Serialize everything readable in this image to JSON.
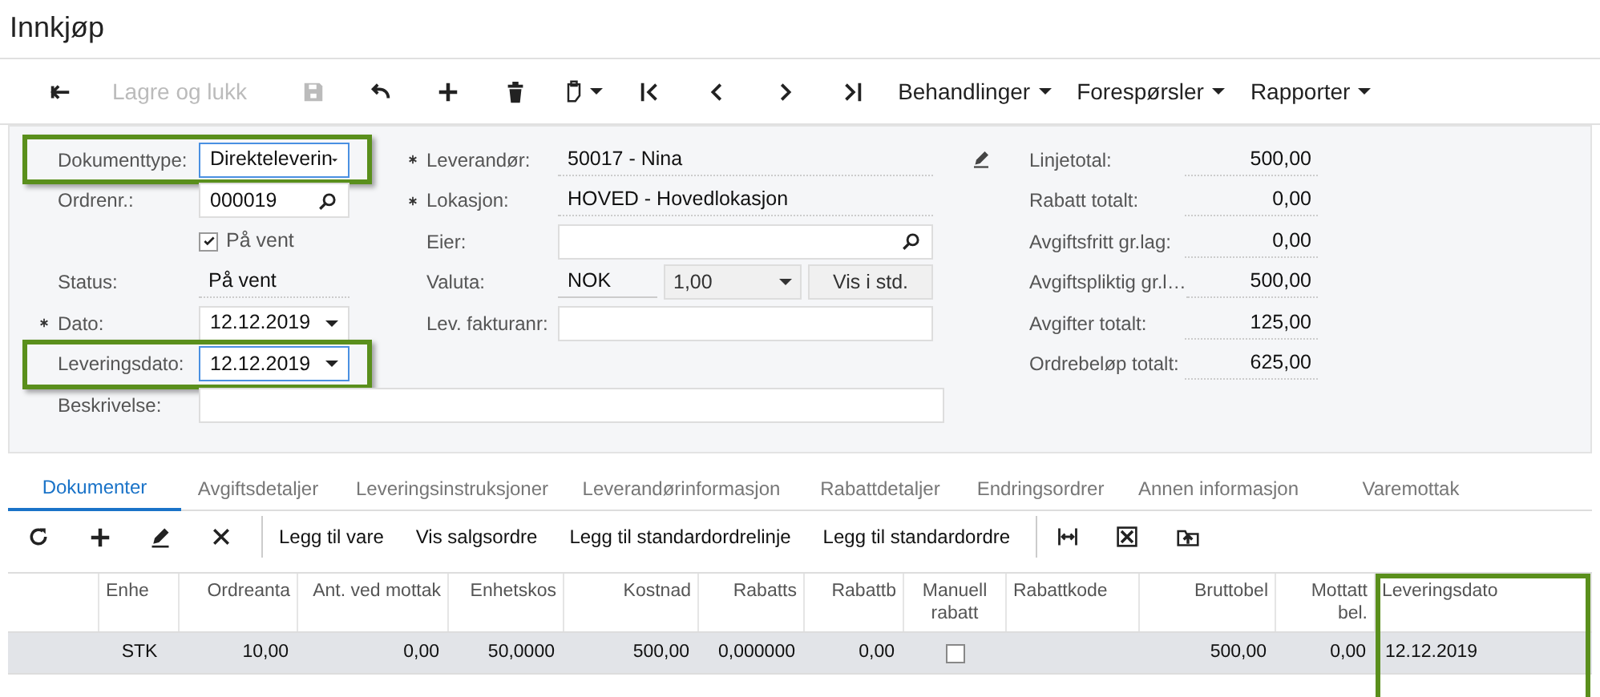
{
  "page_title": "Innkjøp",
  "toolbar": [
    {
      "kind": "back",
      "disabled": false
    },
    {
      "kind": "text",
      "label": "Lagre og lukk",
      "disabled": true
    },
    {
      "kind": "save",
      "disabled": true
    },
    {
      "kind": "undo",
      "disabled": false
    },
    {
      "kind": "add",
      "disabled": false
    },
    {
      "kind": "delete",
      "disabled": false
    },
    {
      "kind": "clipboard",
      "disabled": false
    },
    {
      "kind": "first",
      "disabled": false
    },
    {
      "kind": "prev",
      "disabled": false
    },
    {
      "kind": "next",
      "disabled": false
    },
    {
      "kind": "last",
      "disabled": false
    },
    {
      "kind": "menu",
      "label": "Behandlinger",
      "disabled": false
    },
    {
      "kind": "menu",
      "label": "Forespørsler",
      "disabled": false
    },
    {
      "kind": "menu",
      "label": "Rapporter",
      "disabled": false
    }
  ],
  "form_left": [
    {
      "kind": "select",
      "label": "Dokumenttype:",
      "value": "Direkteleverin",
      "required": false,
      "highlighted": true
    },
    {
      "kind": "lookup",
      "label": "Ordrenr.:",
      "value": "000019",
      "required": false,
      "highlighted": false
    },
    {
      "kind": "checkbox",
      "label": "På vent",
      "checked": true
    },
    {
      "kind": "readonly",
      "label": "Status:",
      "value": "På vent",
      "required": false,
      "highlighted": false
    },
    {
      "kind": "select",
      "label": "Dato:",
      "value": "12.12.2019",
      "required": true,
      "highlighted": false
    },
    {
      "kind": "select",
      "label": "Leveringsdato:",
      "value": "12.12.2019",
      "required": false,
      "highlighted": true
    },
    {
      "kind": "wide",
      "label": "Beskrivelse:",
      "required": false,
      "highlighted": false
    }
  ],
  "form_middle": [
    {
      "kind": "readonly",
      "label": "Leverandør:",
      "value": "50017 - Nina",
      "required": true
    },
    {
      "kind": "readonly",
      "label": "Lokasjon:",
      "value": "HOVED - Hovedlokasjon",
      "required": true
    },
    {
      "kind": "lookup",
      "label": "Eier:",
      "required": false
    },
    {
      "kind": "currency",
      "label": "Valuta:",
      "value": "NOK",
      "rate": "1,00",
      "button": "Vis i std.",
      "required": false
    },
    {
      "kind": "input",
      "label": "Lev. fakturanr:",
      "required": false
    }
  ],
  "totals": [
    {
      "label": "Linjetotal:",
      "value": "500,00"
    },
    {
      "label": "Rabatt totalt:",
      "value": "0,00"
    },
    {
      "label": "Avgiftsfritt gr.lag:",
      "value": "0,00"
    },
    {
      "label": "Avgiftspliktig gr.l…",
      "value": "500,00"
    },
    {
      "label": "Avgifter totalt:",
      "value": "125,00"
    },
    {
      "label": "Ordrebeløp totalt:",
      "value": "625,00"
    }
  ],
  "tabs": [
    {
      "label": "Dokumenter",
      "selected": true
    },
    {
      "label": "Avgiftsdetaljer",
      "selected": false
    },
    {
      "label": "Leveringsinstruksjoner",
      "selected": false
    },
    {
      "label": "Leverandørinformasjon",
      "selected": false
    },
    {
      "label": "Rabattdetaljer",
      "selected": false
    },
    {
      "label": "Endringsordrer",
      "selected": false
    },
    {
      "label": "Annen informasjon",
      "selected": false
    },
    {
      "label": "Varemottak",
      "selected": false
    }
  ],
  "grid_toolbar": [
    {
      "kind": "refresh"
    },
    {
      "kind": "add"
    },
    {
      "kind": "edit"
    },
    {
      "kind": "close"
    },
    {
      "kind": "text",
      "label": "Legg til vare"
    },
    {
      "kind": "text",
      "label": "Vis salgsordre"
    },
    {
      "kind": "text",
      "label": "Legg til standardordrelinje"
    },
    {
      "kind": "text",
      "label": "Legg til standardordre"
    },
    {
      "kind": "fit"
    },
    {
      "kind": "excel"
    },
    {
      "kind": "upload"
    }
  ],
  "table": {
    "columns": [
      {
        "label": "Enhe",
        "highlighted": false
      },
      {
        "label": "Ordreanta",
        "highlighted": false
      },
      {
        "label": "Ant. ved mottak",
        "highlighted": false
      },
      {
        "label": "Enhetskos",
        "highlighted": false
      },
      {
        "label": "Kostnad",
        "highlighted": false
      },
      {
        "label": "Rabatts",
        "highlighted": false
      },
      {
        "label": "Rabattb",
        "highlighted": false
      },
      {
        "label": "Manuell rabatt",
        "highlighted": false
      },
      {
        "label": "Rabattkode",
        "highlighted": false
      },
      {
        "label": "Bruttobel",
        "highlighted": false
      },
      {
        "label": "Mottatt bel.",
        "highlighted": false
      },
      {
        "label": "Leveringsdato",
        "highlighted": true
      }
    ],
    "rows": [
      {
        "selected": true,
        "cells": [
          {
            "kind": "text",
            "value": "STK"
          },
          {
            "kind": "text",
            "value": "10,00"
          },
          {
            "kind": "text",
            "value": "0,00"
          },
          {
            "kind": "text",
            "value": "50,0000"
          },
          {
            "kind": "text",
            "value": "500,00"
          },
          {
            "kind": "text",
            "value": "0,000000"
          },
          {
            "kind": "text",
            "value": "0,00"
          },
          {
            "kind": "checkbox",
            "checked": false
          },
          {
            "kind": "text"
          },
          {
            "kind": "text",
            "value": "500,00"
          },
          {
            "kind": "text",
            "value": "0,00"
          },
          {
            "kind": "text",
            "value": "12.12.2019"
          }
        ]
      }
    ]
  }
}
